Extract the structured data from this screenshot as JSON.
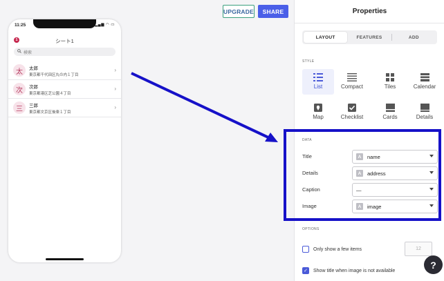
{
  "topbar": {
    "upgrade_label": "UPGRADE",
    "share_label": "SHARE"
  },
  "phone": {
    "status_time": "11:25",
    "status_icons": "▂▄▆ ◠ ▭",
    "sheet_title": "シート1",
    "alert_count": "1",
    "search_placeholder": "検索",
    "items": [
      {
        "initial": "太",
        "name": "太郎",
        "address": "東京都千代田区丸の内１丁目"
      },
      {
        "initial": "次",
        "name": "次郎",
        "address": "東京都港区芝公園４丁目"
      },
      {
        "initial": "三",
        "name": "三郎",
        "address": "東京都文京区後楽１丁目"
      }
    ]
  },
  "panel": {
    "title": "Properties",
    "tabs": [
      {
        "label": "LAYOUT",
        "active": true
      },
      {
        "label": "FEATURES",
        "active": false
      },
      {
        "label": "ADD",
        "active": false
      }
    ],
    "style_label": "STYLE",
    "styles": [
      {
        "label": "List",
        "icon": "list-icon",
        "selected": true
      },
      {
        "label": "Compact",
        "icon": "compact-icon",
        "selected": false
      },
      {
        "label": "Tiles",
        "icon": "tiles-icon",
        "selected": false
      },
      {
        "label": "Calendar",
        "icon": "calendar-icon",
        "selected": false
      },
      {
        "label": "Map",
        "icon": "map-icon",
        "selected": false
      },
      {
        "label": "Checklist",
        "icon": "checklist-icon",
        "selected": false
      },
      {
        "label": "Cards",
        "icon": "cards-icon",
        "selected": false
      },
      {
        "label": "Details",
        "icon": "details-icon",
        "selected": false
      }
    ],
    "data_label": "DATA",
    "fields": [
      {
        "label": "Title",
        "value": "name",
        "has_type": true,
        "type_glyph": "A"
      },
      {
        "label": "Details",
        "value": "address",
        "has_type": true,
        "type_glyph": "A"
      },
      {
        "label": "Caption",
        "value": "—",
        "has_type": false,
        "type_glyph": ""
      },
      {
        "label": "Image",
        "value": "image",
        "has_type": true,
        "type_glyph": "A"
      }
    ],
    "options_label": "OPTIONS",
    "options": [
      {
        "label": "Only show a few items",
        "checked": false
      },
      {
        "label": "Show title when image is not available",
        "checked": true
      }
    ],
    "few_items_count": "12",
    "help_label": "?"
  },
  "colors": {
    "accent": "#4a5fe8",
    "annotation_blue": "#1611c8",
    "avatar_bg": "#f7e2e9",
    "avatar_text": "#b53c60"
  }
}
